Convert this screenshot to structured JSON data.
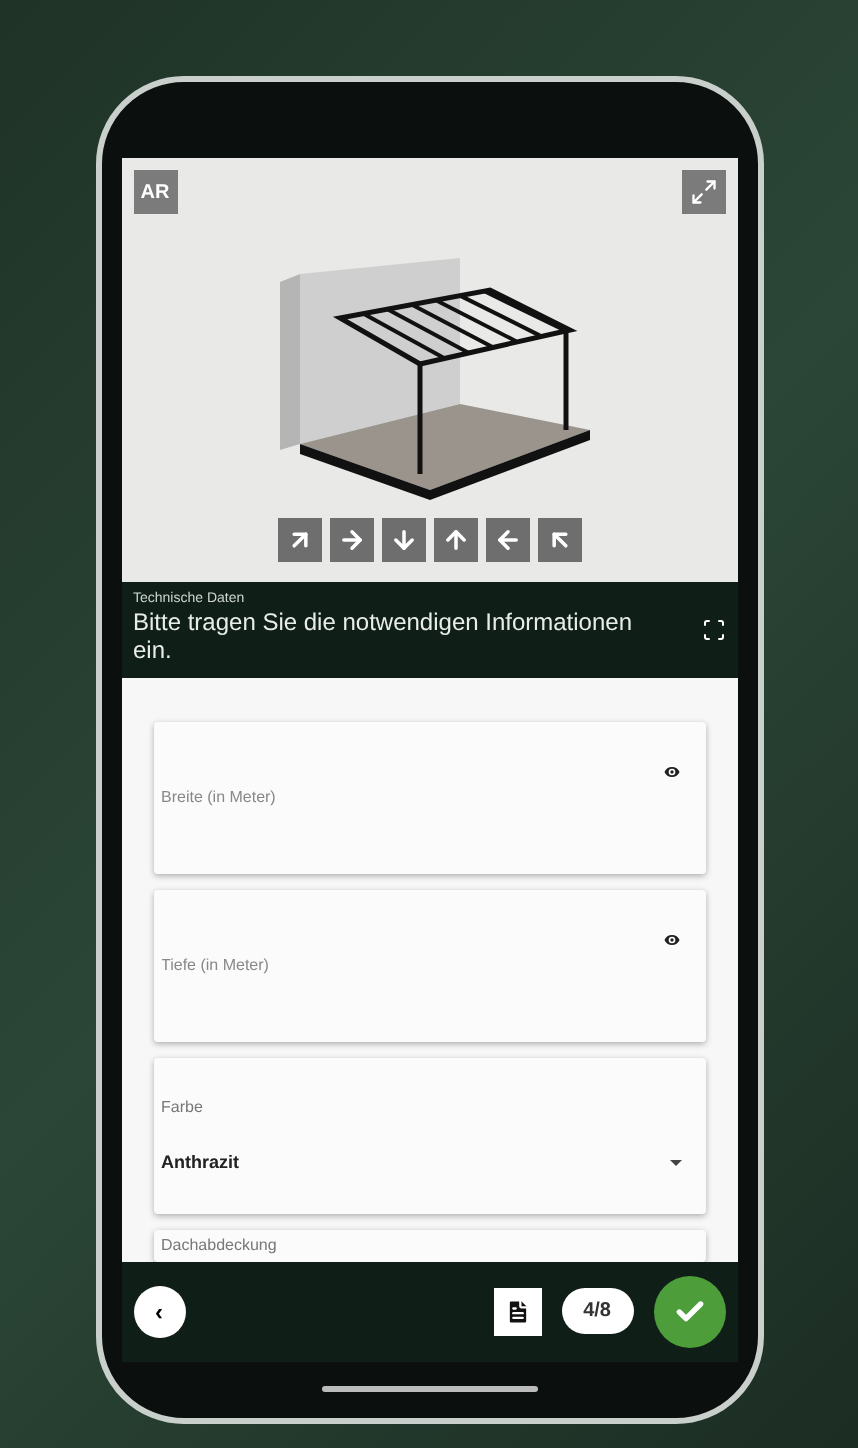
{
  "viewer": {
    "ar_label": "AR"
  },
  "header": {
    "caption": "Technische Daten",
    "title": "Bitte tragen Sie die notwendigen Informationen ein."
  },
  "fields": [
    {
      "kind": "number",
      "placeholder": "Breite (in Meter)"
    },
    {
      "kind": "number",
      "placeholder": "Tiefe (in Meter)"
    },
    {
      "kind": "select",
      "label": "Farbe",
      "value": "Anthrazit"
    },
    {
      "kind": "partial",
      "label": "Dachabdeckung"
    }
  ],
  "footer": {
    "back": "‹",
    "step": "4/8"
  }
}
